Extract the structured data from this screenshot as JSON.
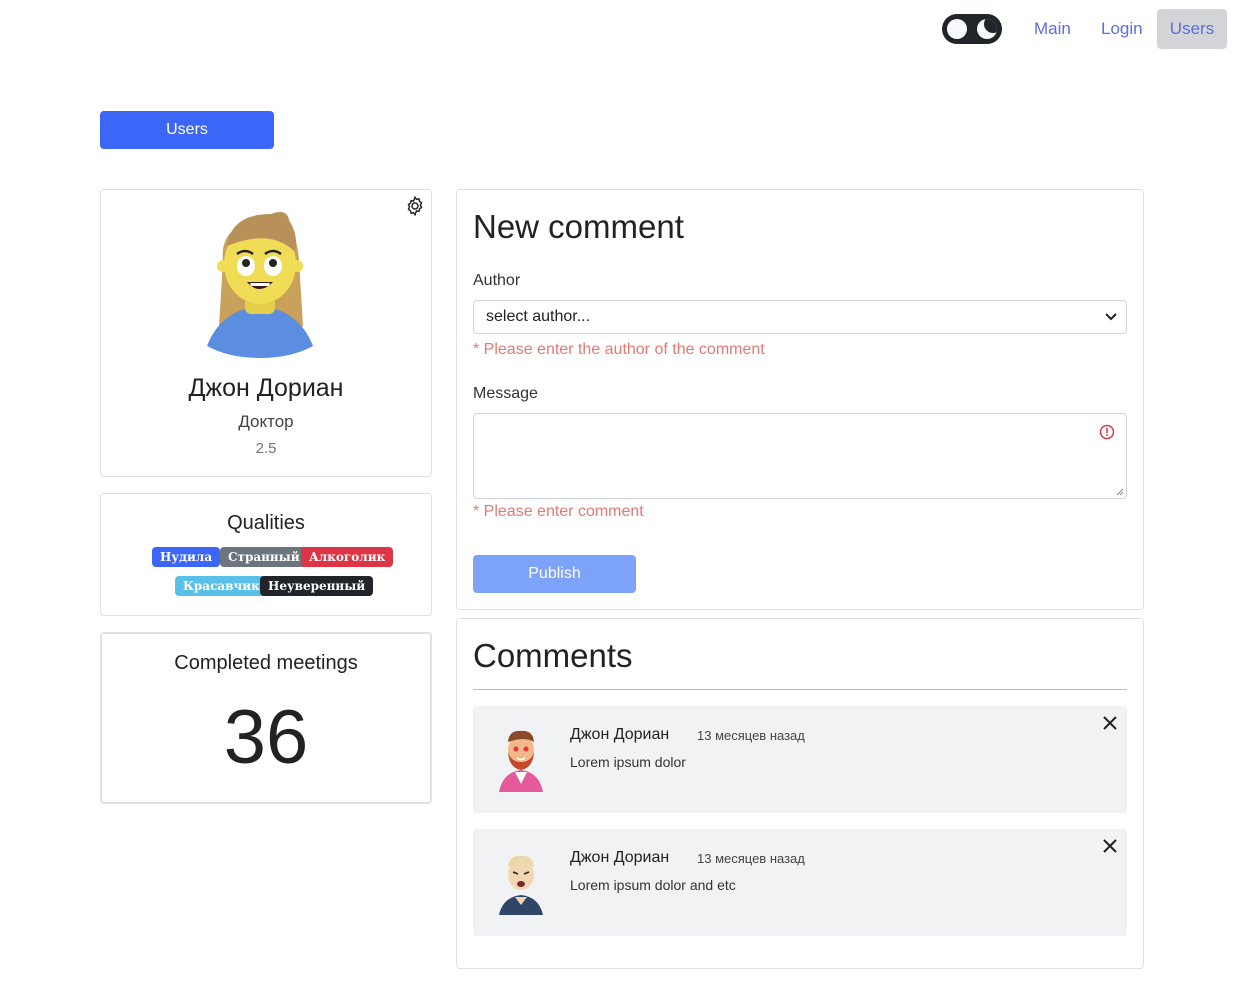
{
  "nav": {
    "links": [
      {
        "label": "Main"
      },
      {
        "label": "Login"
      },
      {
        "label": "Users",
        "active": true
      }
    ],
    "theme_toggle_icon": "moon-icon"
  },
  "users_button": {
    "label": "Users"
  },
  "profile": {
    "name": "Джон Дориан",
    "profession": "Доктор",
    "rate": "2.5",
    "settings_icon": "gear-icon"
  },
  "qualities": {
    "title": "Qualities",
    "items": [
      {
        "label": "Нудила",
        "color": "#3c66f8"
      },
      {
        "label": "Странный",
        "color": "#6c757d"
      },
      {
        "label": "Алкоголик",
        "color": "#dc3545"
      },
      {
        "label": "Красавчик",
        "color": "#59c0ea"
      },
      {
        "label": "Неуверенный",
        "color": "#212529"
      }
    ]
  },
  "meetings": {
    "title": "Completed meetings",
    "value": "36"
  },
  "new_comment": {
    "title": "New comment",
    "author_label": "Author",
    "author_select_value": "select author...",
    "author_error": "* Please enter the author of the comment",
    "message_label": "Message",
    "message_value": "",
    "message_error": "* Please enter comment",
    "publish_label": "Publish"
  },
  "comments": {
    "title": "Comments",
    "items": [
      {
        "author": "Джон Дориан",
        "time": "13 месяцев назад",
        "text": "Lorem ipsum dolor"
      },
      {
        "author": "Джон Дориан",
        "time": "13 месяцев назад",
        "text": "Lorem ipsum dolor and etc"
      }
    ]
  },
  "colors": {
    "primary": "#3c66f8",
    "link": "#5c6ee0",
    "error": "#e17a73",
    "publish_disabled": "#7da2f9"
  }
}
